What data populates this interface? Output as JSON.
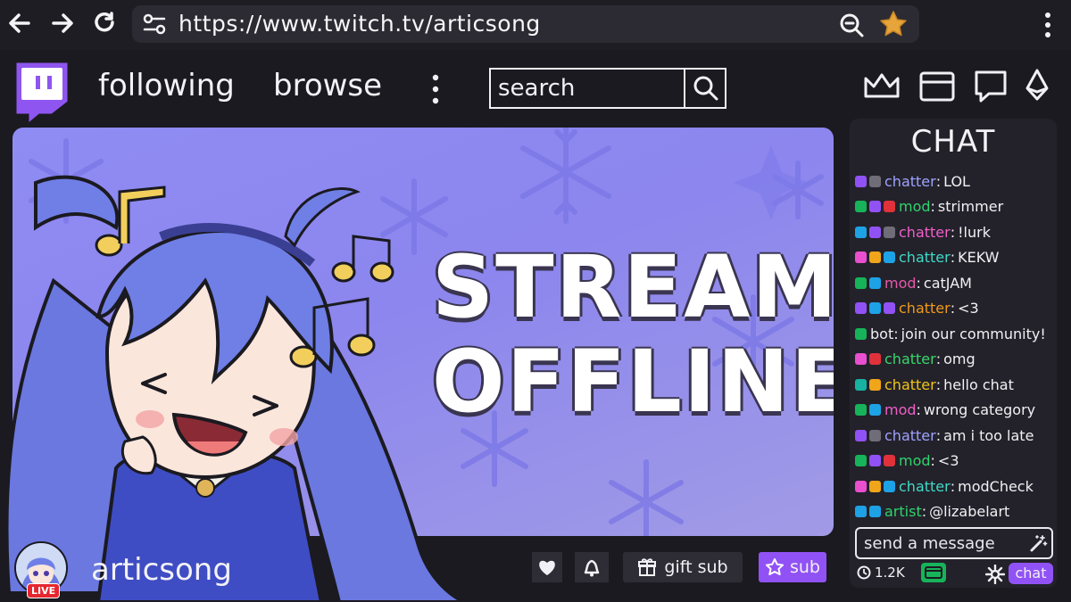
{
  "browser": {
    "url": "https://www.twitch.tv/articsong",
    "back_icon": "arrow-left-icon",
    "forward_icon": "arrow-right-icon",
    "reload_icon": "reload-icon"
  },
  "header": {
    "nav": [
      "following",
      "browse"
    ],
    "search_placeholder": "search",
    "icons": [
      "crown-icon",
      "inbox-icon",
      "whisper-icon",
      "bits-icon"
    ]
  },
  "stream": {
    "status_line1": "STREAM",
    "status_line2": "OFFLINE"
  },
  "channel": {
    "name": "articsong",
    "live_badge": "LIVE",
    "gift_label": "gift sub",
    "sub_label": "sub"
  },
  "chat": {
    "title": "CHAT",
    "messages": [
      {
        "badges": [
          "#9152f5",
          "#6f6d78"
        ],
        "user": "chatter",
        "color": "#9ea1ff",
        "text": "LOL"
      },
      {
        "badges": [
          "#17b35a",
          "#9152f5",
          "#e0323b"
        ],
        "user": "mod",
        "color": "#2fd36d",
        "text": "strimmer"
      },
      {
        "badges": [
          "#1ea2e6",
          "#9152f5",
          "#6f6d78"
        ],
        "user": "chatter",
        "color": "#f05fc9",
        "text": "!lurk"
      },
      {
        "badges": [
          "#e94fcf",
          "#f0a51a",
          "#1ea2e6"
        ],
        "user": "chatter",
        "color": "#41d9c8",
        "text": "KEKW"
      },
      {
        "badges": [
          "#17b35a",
          "#1ea2e6"
        ],
        "user": "mod",
        "color": "#e659a8",
        "text": "catJAM"
      },
      {
        "badges": [
          "#9152f5",
          "#1ea2e6",
          "#9152f5"
        ],
        "user": "chatter",
        "color": "#f09a1c",
        "text": "<3"
      },
      {
        "badges": [
          "#17b35a"
        ],
        "user": "bot",
        "color": "#f1f0f4",
        "text": "join our community!"
      },
      {
        "badges": [
          "#e94fcf",
          "#e0323b"
        ],
        "user": "chatter",
        "color": "#3ad66b",
        "text": "omg"
      },
      {
        "badges": [
          "#17b3a0",
          "#f0a51a"
        ],
        "user": "chatter",
        "color": "#f0c419",
        "text": "hello chat"
      },
      {
        "badges": [
          "#17b35a",
          "#1ea2e6"
        ],
        "user": "mod",
        "color": "#f05fc9",
        "text": "wrong category"
      },
      {
        "badges": [
          "#9152f5",
          "#6f6d78"
        ],
        "user": "chatter",
        "color": "#9ea1ff",
        "text": "am i too late"
      },
      {
        "badges": [
          "#17b35a",
          "#9152f5",
          "#e0323b"
        ],
        "user": "mod",
        "color": "#2fd36d",
        "text": "<3"
      },
      {
        "badges": [
          "#e94fcf",
          "#f0a51a",
          "#1ea2e6"
        ],
        "user": "chatter",
        "color": "#41d9c8",
        "text": "modCheck"
      },
      {
        "badges": [
          "#1ea2e6",
          "#1ea2e6"
        ],
        "user": "artist",
        "color": "#2fd36d",
        "text": "@lizabelart"
      }
    ],
    "input_placeholder": "send a message",
    "viewer_count": "1.2K",
    "chat_button": "chat"
  }
}
